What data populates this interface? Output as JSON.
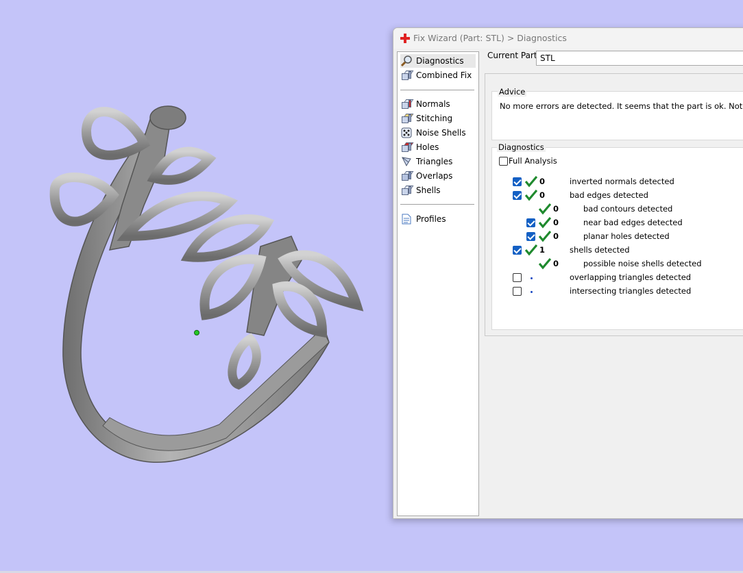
{
  "window": {
    "title": "Fix Wizard (Part: STL) > Diagnostics"
  },
  "nav": {
    "items": [
      {
        "label": "Diagnostics",
        "icon": "magnifier-icon"
      },
      {
        "label": "Combined Fix",
        "icon": "cube-icon"
      },
      {
        "label": "Normals",
        "icon": "cube-red-face-icon"
      },
      {
        "label": "Stitching",
        "icon": "cube-stitch-icon"
      },
      {
        "label": "Noise Shells",
        "icon": "dice-icon"
      },
      {
        "label": "Holes",
        "icon": "cube-red-top-icon"
      },
      {
        "label": "Triangles",
        "icon": "triangles-icon"
      },
      {
        "label": "Overlaps",
        "icon": "cube-overlap-icon"
      },
      {
        "label": "Shells",
        "icon": "cube-icon"
      },
      {
        "label": "Profiles",
        "icon": "document-icon"
      }
    ]
  },
  "current_part": {
    "label": "Current Part:",
    "value": "STL"
  },
  "advice": {
    "legend": "Advice",
    "text": "No more errors are detected. It seems that the part is ok. Note that not al"
  },
  "diagnostics": {
    "legend": "Diagnostics",
    "full_analysis": {
      "label": "Full Analysis",
      "checked": false
    },
    "rows": [
      {
        "checked": true,
        "count": "0",
        "status": "ok",
        "label": "inverted normals detected"
      },
      {
        "checked": true,
        "count": "0",
        "status": "ok",
        "label": "bad edges detected"
      },
      {
        "checked": null,
        "count": "0",
        "status": "ok",
        "label": "bad contours detected"
      },
      {
        "checked": true,
        "count": "0",
        "status": "ok",
        "label": "near bad edges detected"
      },
      {
        "checked": true,
        "count": "0",
        "status": "ok",
        "label": "planar holes detected"
      },
      {
        "checked": true,
        "count": "1",
        "status": "ok",
        "label": "shells detected"
      },
      {
        "checked": null,
        "count": "0",
        "status": "ok",
        "label": "possible noise shells detected"
      },
      {
        "checked": false,
        "count": "",
        "status": "not-analyzed",
        "label": "overlapping triangles detected"
      },
      {
        "checked": false,
        "count": "",
        "status": "not-analyzed",
        "label": "intersecting triangles detected"
      }
    ]
  },
  "colors": {
    "viewport_background": "#c4c4f9",
    "model_gray": "#8f8f8f",
    "checkbox_blue": "#1460c4",
    "check_green": "#1f8a2e",
    "origin_marker": "#25c825"
  }
}
